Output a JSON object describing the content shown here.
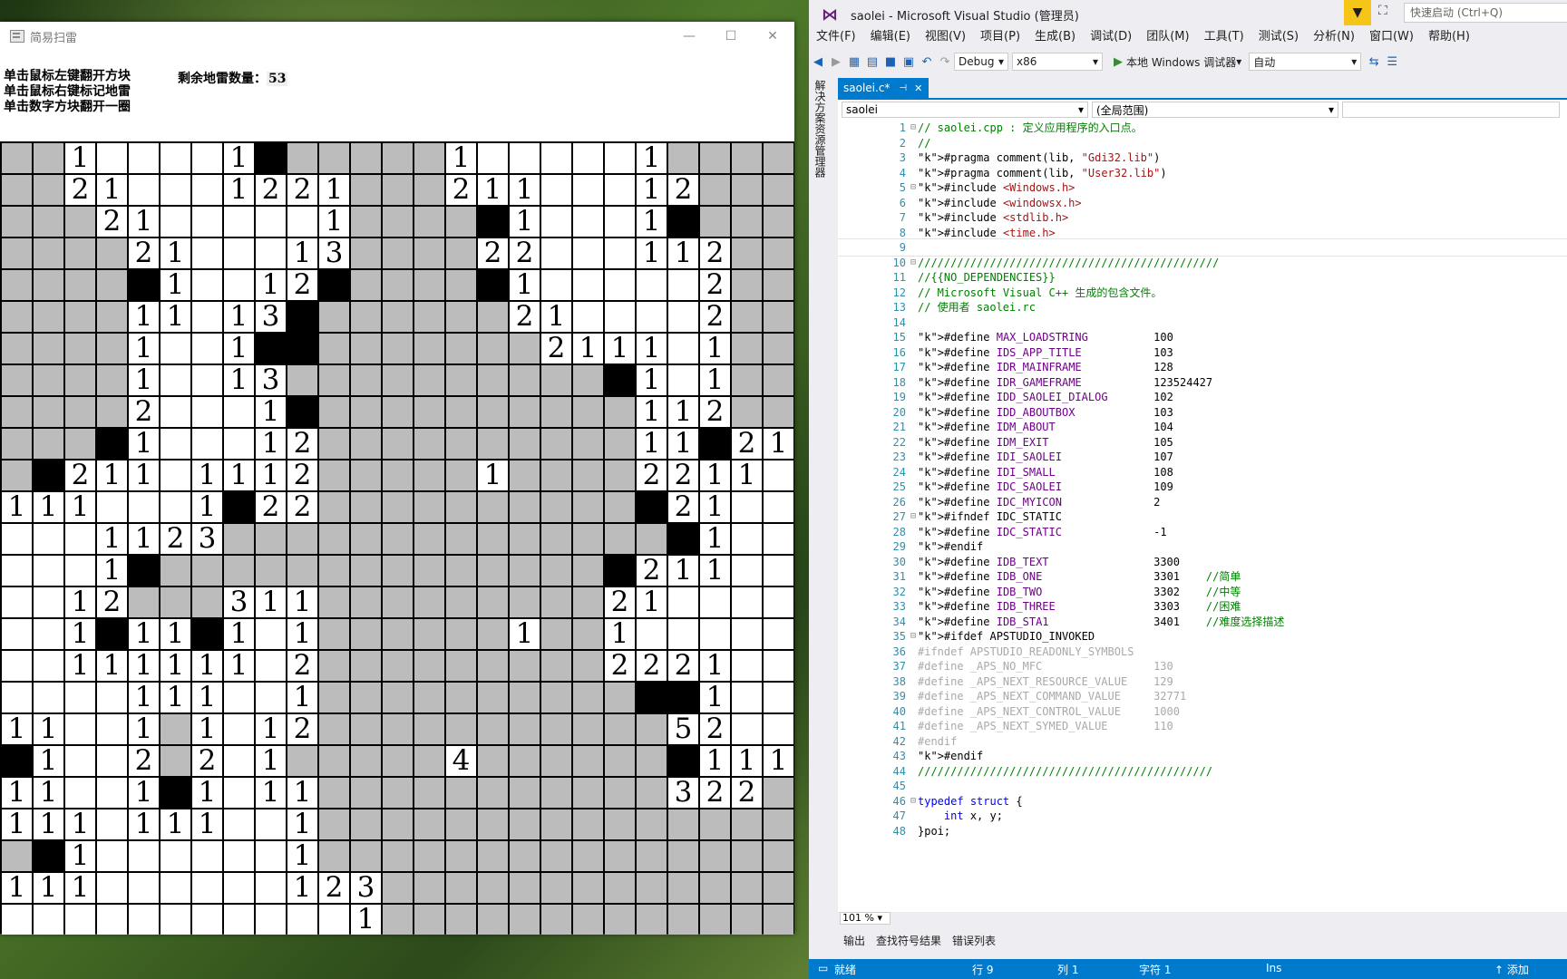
{
  "minesweeper": {
    "title": "简易扫雷",
    "instructions": [
      "单击鼠标左键翻开方块",
      "单击鼠标右键标记地雷",
      "单击数字方块翻开一圈"
    ],
    "mines_label": "剩余地雷数量：",
    "mines_count": "53",
    "grid": [
      "u u 1 o o o o 1 M u u u u u 1 o o o o o 1 u u u u",
      "u u 2 1 o o o 1 2 2 1 u u u 2 1 1 o o o 1 2 u u u",
      "u u u 2 1 o o o o o 1 u u u u M 1 o o o 1 M u u u",
      "u u u u 2 1 o o o 1 3 u u u u 2 2 o o o 1 1 2 u u",
      "u u u u M 1 o o 1 2 M u u u u M 1 o o o o o 2 u u",
      "u u u u 1 1 o 1 3 M u u u u u u 2 1 o o o o 2 u u",
      "u u u u 1 o o 1 M M u u u u u u u 2 1 1 1 o 1 u u",
      "u u u u 1 o o 1 3 u u u u u u u u u u M 1 o 1 u u",
      "u u u u 2 o o o 1 M u u u u u u u u u u 1 1 2 u u",
      "u u u M 1 o o o 1 2 u u u u u u u u u u 1 1 M 2 1",
      "u M 2 1 1 o 1 1 1 2 u u u u u 1 u u u u 2 2 1 1 o",
      "1 1 1 o o o 1 M 2 2 u u u u u u u u u u M 2 1 o o",
      "o o o 1 1 2 3 u u u u u u u u u u u u u u M 1 o o",
      "o o o 1 M u u u u u u u u u u u u u u M 2 1 1 o o",
      "o o 1 2 u u u 3 1 1 u u u u u u u u u 2 1 o o o o",
      "o o 1 M 1 1 M 1 o 1 u u u u u u 1 u u 1 o o o o o",
      "o o 1 1 1 1 1 1 o 2 u u u u u u u u u 2 2 2 1 o o",
      "o o o o 1 1 1 o o 1 u u u u u u u u u u M M 1 o o",
      "1 1 o o 1 u 1 o 1 2 u u u u u u u u u u u 5 2 o o",
      "M 1 o o 2 u 2 o 1 u u u u u 4 u u u u u u M 1 1 1",
      "1 1 o o 1 M 1 o 1 1 u u u u u u u u u u u 3 2 2 u",
      "1 1 1 o 1 1 1 o o 1 u u u u u u u u u u u u u u u",
      "u M 1 o o o o o o 1 u u u u u u u u u u u u u u u",
      "1 1 1 o o o o o o 1 2 3 u u u u u u u u u u u u u",
      "o o o o o o o o o o o 1 u u u u u u u u u u u u u"
    ]
  },
  "vs": {
    "title": "saolei - Microsoft Visual Studio (管理员)",
    "quick_launch_placeholder": "快速启动 (Ctrl+Q)",
    "menu": [
      "文件(F)",
      "编辑(E)",
      "视图(V)",
      "项目(P)",
      "生成(B)",
      "调试(D)",
      "团队(M)",
      "工具(T)",
      "测试(S)",
      "分析(N)",
      "窗口(W)",
      "帮助(H)"
    ],
    "config": "Debug",
    "platform": "x86",
    "run_label": "本地 Windows 调试器",
    "auto": "自动",
    "side_panel": "解决方案资源管理器",
    "tab_name": "saolei.c*",
    "nav_project": "saolei",
    "nav_scope": "(全局范围)",
    "zoom": "101 %",
    "output_tabs": [
      "输出",
      "查找符号结果",
      "错误列表"
    ],
    "status": {
      "ready": "就绪",
      "line": "行 9",
      "col": "列 1",
      "char": "字符 1",
      "ins": "Ins",
      "add": "↑ 添加"
    },
    "code_lines": [
      "1",
      "2",
      "3",
      "4",
      "5",
      "6",
      "7",
      "8",
      "9",
      "10",
      "11",
      "12",
      "13",
      "14",
      "15",
      "16",
      "17",
      "18",
      "19",
      "20",
      "21",
      "22",
      "23",
      "24",
      "25",
      "26",
      "27",
      "28",
      "29",
      "30",
      "31",
      "32",
      "33",
      "34",
      "35",
      "36",
      "37",
      "38",
      "39",
      "40",
      "41",
      "42",
      "43",
      "44",
      "45",
      "46",
      "47",
      "48"
    ],
    "code": [
      "// saolei.cpp : 定义应用程序的入口点。",
      "//",
      "#pragma comment(lib, \"Gdi32.lib\")",
      "#pragma comment(lib, \"User32.lib\")",
      "#include <Windows.h>",
      "#include <windowsx.h>",
      "#include <stdlib.h>",
      "#include <time.h>",
      "",
      "//////////////////////////////////////////////",
      "//{{NO_DEPENDENCIES}}",
      "// Microsoft Visual C++ 生成的包含文件。",
      "// 使用者 saolei.rc",
      "",
      "#define MAX_LOADSTRING          100",
      "#define IDS_APP_TITLE           103",
      "#define IDR_MAINFRAME           128",
      "#define IDR_GAMEFRAME           123524427",
      "#define IDD_SAOLEI_DIALOG       102",
      "#define IDD_ABOUTBOX            103",
      "#define IDM_ABOUT               104",
      "#define IDM_EXIT                105",
      "#define IDI_SAOLEI              107",
      "#define IDI_SMALL               108",
      "#define IDC_SAOLEI              109",
      "#define IDC_MYICON              2",
      "#ifndef IDC_STATIC",
      "#define IDC_STATIC              -1",
      "#endif",
      "#define IDB_TEXT                3300",
      "#define IDB_ONE                 3301    //简单",
      "#define IDB_TWO                 3302    //中等",
      "#define IDB_THREE               3303    //困难",
      "#define IDB_STA1                3401    //难度选择描述",
      "#ifdef APSTUDIO_INVOKED",
      "#ifndef APSTUDIO_READONLY_SYMBOLS",
      "#define _APS_NO_MFC                 130",
      "#define _APS_NEXT_RESOURCE_VALUE    129",
      "#define _APS_NEXT_COMMAND_VALUE     32771",
      "#define _APS_NEXT_CONTROL_VALUE     1000",
      "#define _APS_NEXT_SYMED_VALUE       110",
      "#endif",
      "#endif",
      "/////////////////////////////////////////////",
      "",
      "typedef struct {",
      "    int x, y;",
      "}poi;"
    ]
  }
}
